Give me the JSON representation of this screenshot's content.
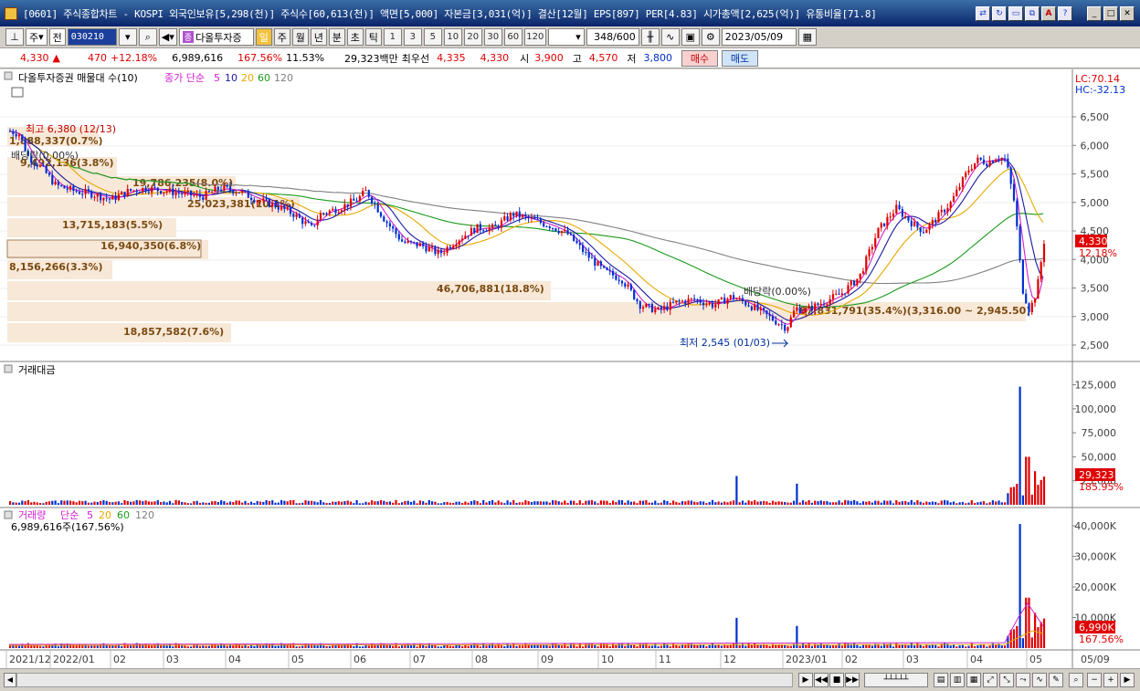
{
  "window": {
    "title": "[0601] 주식종합차트 - KOSPI 외국인보유[5,298(천)] 주식수[60,613(천)] 액면[5,000] 자본금[3,031(억)] 결산[12월] EPS[897] PER[4.83] 시가총액[2,625(억)] 유통비율[71.8]"
  },
  "toolbar": {
    "market": "주",
    "market_scope": "전",
    "code": "030210",
    "stock_name": "다올투자증",
    "stock_badge": "종",
    "periods": [
      "일",
      "주",
      "월",
      "년",
      "분",
      "초",
      "틱"
    ],
    "selected_period": "일",
    "intervals": [
      "1",
      "3",
      "5",
      "10",
      "20",
      "30",
      "60",
      "120"
    ],
    "count": "348",
    "count_max": "/600",
    "date": "2023/05/09"
  },
  "pricebar": {
    "price": "4,330",
    "arrow": "▲",
    "change": "470",
    "change_pct": "+12.18%",
    "volume": "6,989,616",
    "volume_pct": "167.56%",
    "turnover_pct": "11.53%",
    "amount": "29,323백만",
    "best_ask_label": "최우선",
    "best_ask": "4,335",
    "best_bid": "4,330",
    "open_label": "시",
    "open": "3,900",
    "high_label": "고",
    "high": "4,570",
    "low_label": "저",
    "low": "3,800",
    "buy": "매수",
    "sell": "매도"
  },
  "price_panel": {
    "legend_name": "다올투자증권 매물대 수(10)",
    "legend_ma": "종가 단순",
    "ma_periods": [
      "5",
      "10",
      "20",
      "60",
      "120"
    ],
    "lc": "LC:70.14",
    "hc": "HC:-32.13",
    "y_ticks": [
      "6,500",
      "6,000",
      "5,500",
      "5,000",
      "4,500",
      "4,000",
      "3,500",
      "3,000",
      "2,500"
    ],
    "last_price_tag": "4,330",
    "last_pct_tag": "12.18%",
    "high_note": "최고 6,380 (12/13)",
    "low_note": "최저 2,545 (01/03)",
    "dividend_note_1": "배당락(0.00%)",
    "dividend_note_2": "배당락(0.00%)",
    "volume_profile": [
      {
        "label": "1,888,337(0.7%)"
      },
      {
        "label": "9,492,136(3.8%)"
      },
      {
        "label": "19,786,235(8.0%)"
      },
      {
        "label": "25,023,381(10.1%)"
      },
      {
        "label": "13,715,183(5.5%)"
      },
      {
        "label": "16,940,350(6.8%)"
      },
      {
        "label": "8,156,266(3.3%)"
      },
      {
        "label": "46,706,881(18.8%)"
      },
      {
        "label": "87,831,791(35.4%)(3,316.00 ~ 2,945.50)"
      },
      {
        "label": "18,857,582(7.6%)"
      }
    ]
  },
  "amount_panel": {
    "title": "거래대금",
    "y_ticks": [
      "125,000",
      "100,000",
      "75,000",
      "50,000",
      "25,000"
    ],
    "last_tag": "29,323",
    "last_pct": "185.95%"
  },
  "volume_panel": {
    "title": "거래량",
    "legend_ma": "단순",
    "ma_periods": [
      "5",
      "20",
      "60",
      "120"
    ],
    "value_note": "6,989,616주(167.56%)",
    "y_ticks": [
      "40,000K",
      "30,000K",
      "20,000K",
      "10,000K"
    ],
    "last_tag": "6,990K",
    "last_pct": "167.56%"
  },
  "x_axis": {
    "labels": [
      "2021/12",
      "2022/01",
      "02",
      "03",
      "04",
      "05",
      "06",
      "07",
      "08",
      "09",
      "10",
      "11",
      "12",
      "2023/01",
      "02",
      "03",
      "04",
      "05"
    ],
    "right_label": "05/09"
  },
  "colors": {
    "up": "#e00000",
    "down": "#0030d0",
    "ma5": "#d020d0",
    "ma10": "#1a1aa0",
    "ma20": "#e8a800",
    "ma60": "#1a9a1a",
    "ma120": "#808080",
    "profile": "#f8e8d8"
  }
}
